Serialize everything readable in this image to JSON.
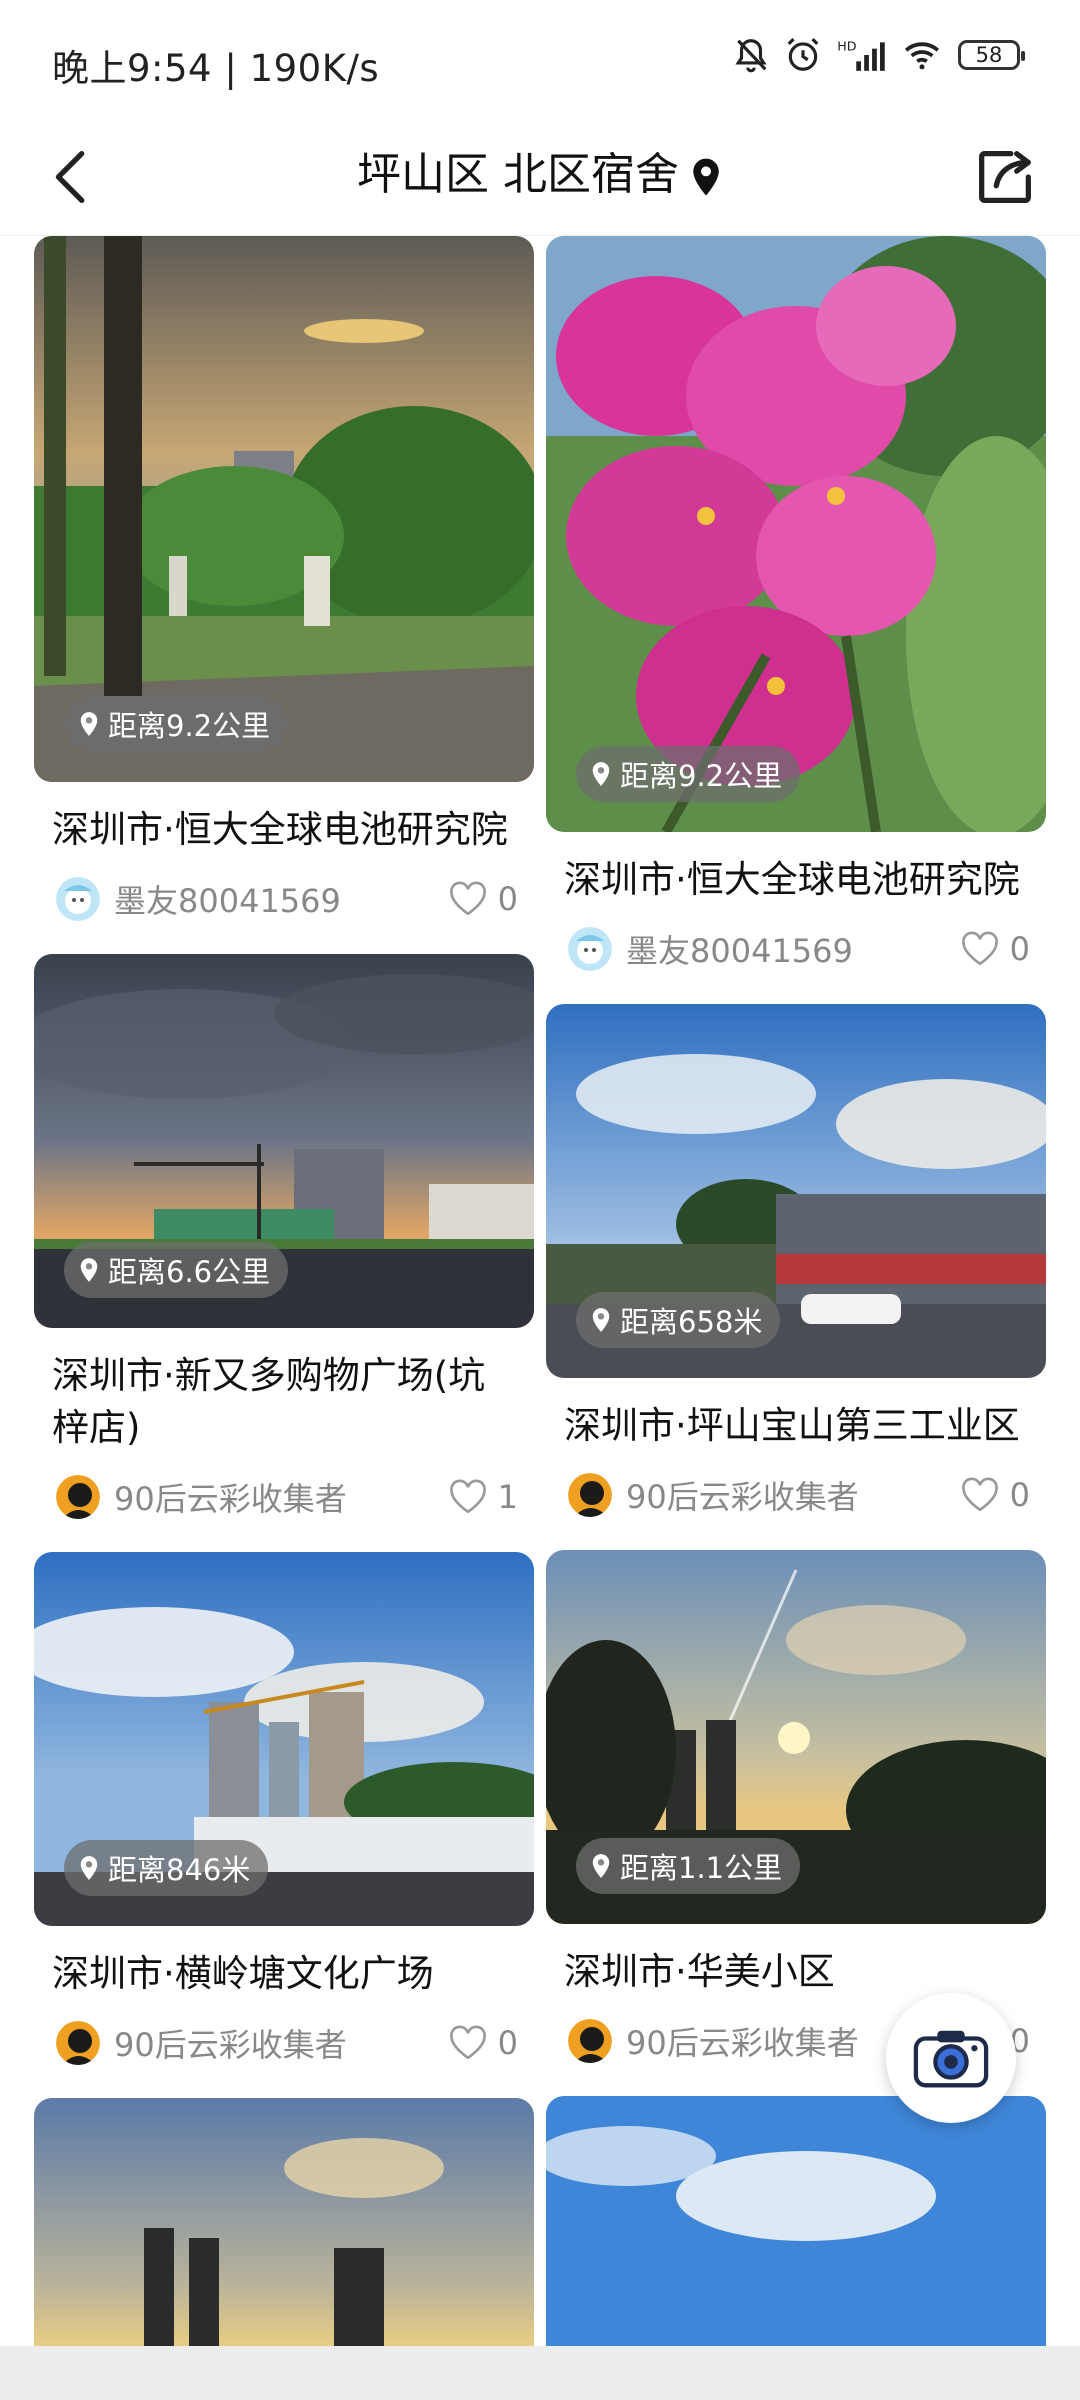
{
  "status_bar": {
    "time": "晚上9:54 | 190K/s",
    "battery": "58"
  },
  "nav": {
    "title": "坪山区 北区宿舍"
  },
  "cards": [
    {
      "distance": "距离9.2公里",
      "title": "深圳市·恒大全球电池研究院",
      "author": "墨友80041569",
      "likes": "0"
    },
    {
      "distance": "距离9.2公里",
      "title": "深圳市·恒大全球电池研究院",
      "author": "墨友80041569",
      "likes": "0"
    },
    {
      "distance": "距离6.6公里",
      "title": "深圳市·新又多购物广场(坑梓店)",
      "author": "90后云彩收集者",
      "likes": "1"
    },
    {
      "distance": "距离658米",
      "title": "深圳市·坪山宝山第三工业区",
      "author": "90后云彩收集者",
      "likes": "0"
    },
    {
      "distance": "距离846米",
      "title": "深圳市·横岭塘文化广场",
      "author": "90后云彩收集者",
      "likes": "0"
    },
    {
      "distance": "距离1.1公里",
      "title": "深圳市·华美小区",
      "author": "90后云彩收集者",
      "likes": "0"
    }
  ]
}
